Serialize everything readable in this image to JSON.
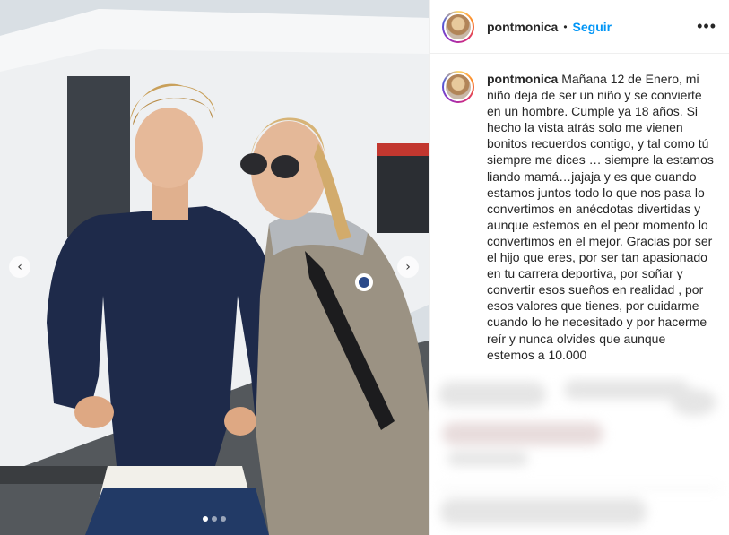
{
  "post": {
    "username": "pontmonica",
    "follow_label": "Seguir",
    "header_separator": "•",
    "more_label": "•••",
    "caption": "Mañana 12 de Enero, mi niño deja de ser un niño y se convierte en un hombre. Cumple ya 18 años. Si hecho la vista atrás solo me vienen bonitos recuerdos contigo, y tal como tú siempre me dices … siempre la estamos liando mamá…jajaja y es que cuando estamos juntos todo lo que nos pasa lo convertimos en anécdotas divertidas y aunque estemos en el peor momento lo convertimos en el mejor. Gracias por ser el hijo que eres, por ser tan apasionado en tu carrera deportiva, por soñar y convertir esos sueños en realidad , por esos valores que tienes, por cuidarme cuando lo he necesitado y por hacerme reír y nunca olvides que aunque estemos a 10.000"
  },
  "media": {
    "prev_icon": "‹",
    "next_icon": "›",
    "carousel_count": 3,
    "carousel_active": 1
  }
}
